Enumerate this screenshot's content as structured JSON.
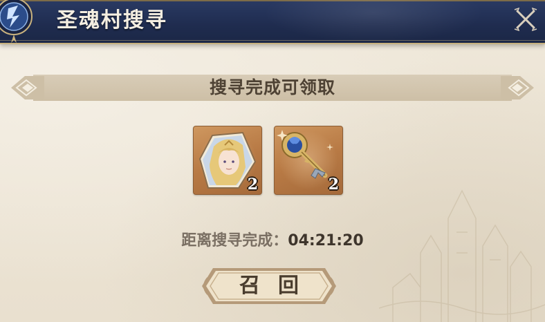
{
  "header": {
    "title": "圣魂村搜寻"
  },
  "banner": {
    "status_text": "搜寻完成可领取"
  },
  "rewards": [
    {
      "icon": "character-portrait-icon",
      "count": "2"
    },
    {
      "icon": "ornate-key-icon",
      "count": "2"
    }
  ],
  "timer": {
    "label": "距离搜寻完成：",
    "value": "04:21:20"
  },
  "actions": {
    "recall_label": "召回"
  },
  "colors": {
    "header_bg": "#1f2c4f",
    "panel_bg": "#ece4d5",
    "item_bg": "#b87a45",
    "text_dark": "#4e4234"
  }
}
